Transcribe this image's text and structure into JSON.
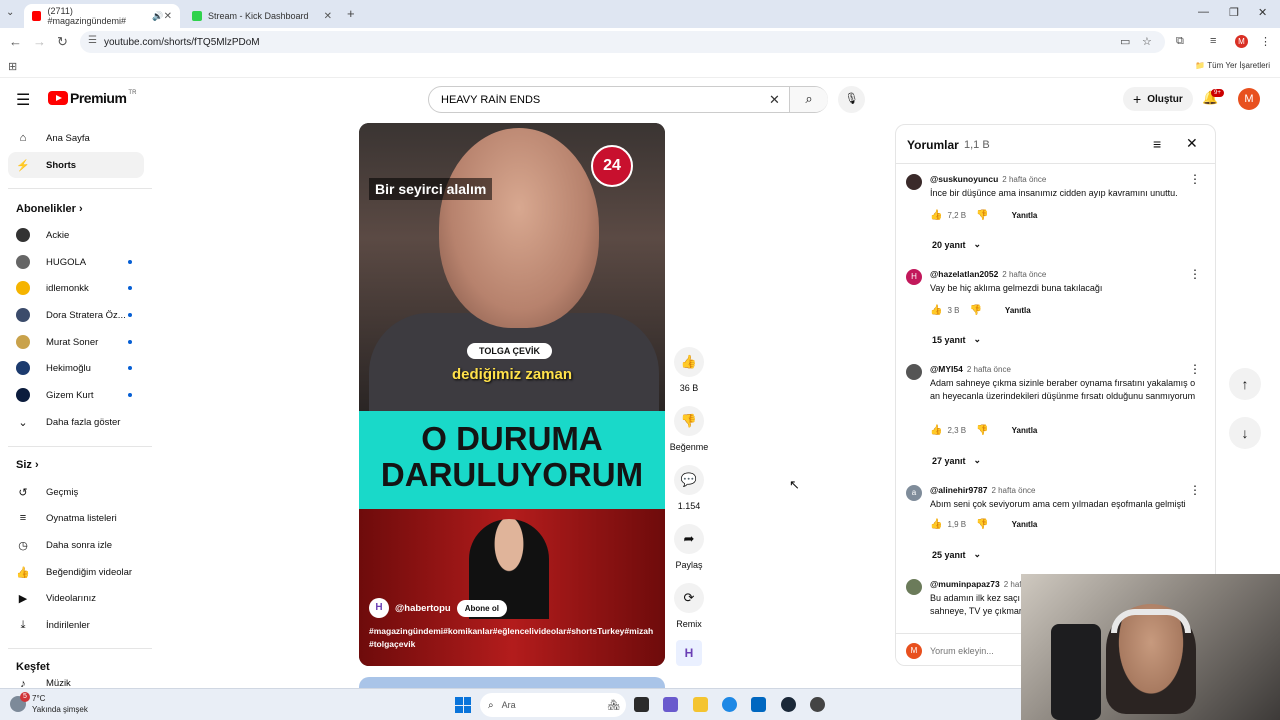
{
  "browser": {
    "tabs": [
      {
        "title": "(2711) #magazingündemi#",
        "active": true,
        "favicon_color": "#ff0000"
      },
      {
        "title": "Stream - Kick Dashboard",
        "active": false,
        "favicon_color": "#2fd24c"
      }
    ],
    "url": "youtube.com/shorts/fTQ5MlzPDoM",
    "profile_initial": "M",
    "bookmarks_all": "Tüm Yer İşaretleri"
  },
  "masthead": {
    "logo_text": "Premium",
    "logo_region": "TR",
    "search_value": "HEAVY RAİN ENDS",
    "create_label": "Oluştur",
    "notifications_badge": "9+",
    "avatar_initial": "M"
  },
  "sidebar": {
    "main": [
      {
        "label": "Ana Sayfa",
        "icon": "home-icon"
      },
      {
        "label": "Shorts",
        "icon": "shorts-icon"
      }
    ],
    "subscriptions_heading": "Abonelikler",
    "subscriptions": [
      {
        "label": "Ackie",
        "color": "#333333",
        "new": false
      },
      {
        "label": "HUGOLA",
        "color": "#666666",
        "new": true
      },
      {
        "label": "idlemonkk",
        "color": "#f5b400",
        "new": true
      },
      {
        "label": "Dora Stratera Öz...",
        "color": "#3b4b6b",
        "new": true
      },
      {
        "label": "Murat Soner",
        "color": "#c9a24b",
        "new": true
      },
      {
        "label": "Hekimoğlu",
        "color": "#1c3b6e",
        "new": true
      },
      {
        "label": "Gizem Kurt",
        "color": "#0b1c3d",
        "new": true
      }
    ],
    "show_more": "Daha fazla göster",
    "you_heading": "Siz",
    "you_items": [
      {
        "label": "Geçmiş",
        "icon": "history-icon"
      },
      {
        "label": "Oynatma listeleri",
        "icon": "playlists-icon"
      },
      {
        "label": "Daha sonra izle",
        "icon": "watch-later-icon"
      },
      {
        "label": "Beğendiğim videolar",
        "icon": "liked-videos-icon"
      },
      {
        "label": "Videolarınız",
        "icon": "your-videos-icon"
      },
      {
        "label": "İndirilenler",
        "icon": "downloads-icon"
      }
    ],
    "explore_heading": "Keşfet",
    "explore_partial": "Müzik"
  },
  "video": {
    "caption_top": "Bir seyirci alalım",
    "logo_24": "24",
    "name_tag": "TOLGA ÇEVİK",
    "caption_mid": "dediğimiz zaman",
    "big_text_line1": "O DURUMA",
    "big_text_line2": "DARULUYORUM",
    "channel": "@habertopu",
    "subscribe": "Abone ol",
    "hashtags": "#magazingündemi#komikanlar#eğlencelivideolar#shortsTurkey#mizah #tolgaçevik"
  },
  "actions": {
    "like_count": "36 B",
    "dislike_label": "Beğenme",
    "comment_count": "1.154",
    "share_label": "Paylaş",
    "remix_label": "Remix"
  },
  "comments_panel": {
    "title": "Yorumlar",
    "count": "1,1 B",
    "reply_label": "Yanıtla",
    "input_placeholder": "Yorum ekleyin...",
    "items": [
      {
        "user": "@suskunoyuncu",
        "time": "2 hafta önce",
        "text": "İnce bir düşünce ama insanımız cidden ayıp kavramını unuttu.",
        "likes": "7,2 B",
        "replies": "20 yanıt",
        "avatar_color": "#3a2a2a",
        "avatar_letter": ""
      },
      {
        "user": "@hazelatlan2052",
        "time": "2 hafta önce",
        "text": "Vay be hiç aklıma gelmezdi buna takılacağı",
        "likes": "3 B",
        "replies": "15 yanıt",
        "avatar_color": "#c2185b",
        "avatar_letter": "H"
      },
      {
        "user": "@MYI54",
        "time": "2 hafta önce",
        "text": "Adam sahneye çıkma sizinle beraber oynama fırsatını yakalamış o an heyecanla üzerindekileri düşünme fırsatı olduğunu sanmıyorum",
        "likes": "2,3 B",
        "replies": "27 yanıt",
        "avatar_color": "#555555",
        "avatar_letter": ""
      },
      {
        "user": "@alinehir9787",
        "time": "2 hafta önce",
        "text": "Abım seni çok seviyorum ama cem yılmadan eşofmanla gelmişti",
        "likes": "1,9 B",
        "replies": "25 yanıt",
        "avatar_color": "#7f8c9a",
        "avatar_letter": "a"
      },
      {
        "user": "@muminpapaz73",
        "time": "2 haft",
        "text": "Bu adamın ilk kez saçı sahneye, TV ye çıkmar",
        "likes": "",
        "replies": "",
        "avatar_color": "#6b7b5a",
        "avatar_letter": ""
      }
    ]
  },
  "taskbar": {
    "temperature": "7°C",
    "weather_text": "Yakında şimşek",
    "weather_badge": "5",
    "search_label": "Ara"
  }
}
